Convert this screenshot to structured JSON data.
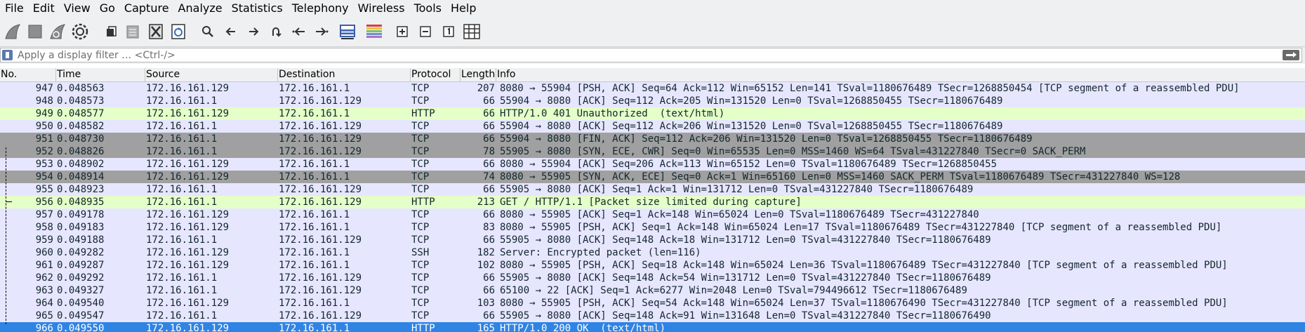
{
  "menu": [
    "File",
    "Edit",
    "View",
    "Go",
    "Capture",
    "Analyze",
    "Statistics",
    "Telephony",
    "Wireless",
    "Tools",
    "Help"
  ],
  "toolbar_icons": [
    "shark-fin-start-icon",
    "stop-square-icon",
    "shark-fin-restart-icon",
    "gear-options-icon",
    "open-file-icon",
    "save-file-icon",
    "close-file-icon",
    "reload-file-icon",
    "search-icon",
    "arrow-left-icon",
    "arrow-right-icon",
    "jump-to-packet-icon",
    "first-packet-icon",
    "last-packet-icon",
    "auto-scroll-icon",
    "colorize-icon",
    "zoom-in-icon",
    "zoom-out-icon",
    "zoom-normal-icon",
    "resize-columns-icon"
  ],
  "filter": {
    "placeholder": "Apply a display filter … <Ctrl-/>"
  },
  "columns": {
    "no": "No.",
    "time": "Time",
    "source": "Source",
    "destination": "Destination",
    "protocol": "Protocol",
    "length": "Length",
    "info": "Info"
  },
  "colors": {
    "tcp": "#e7e6ff",
    "http": "#e4ffc7",
    "syn_fin": "#a0a0a0",
    "selected": "#2f84e3",
    "text": "#12272e"
  },
  "packets": [
    {
      "no": "947",
      "time": "0.048563",
      "source": "172.16.161.129",
      "destination": "172.16.161.1",
      "protocol": "TCP",
      "length": "207",
      "info": "8080 → 55904 [PSH, ACK] Seq=64 Ack=112 Win=65152 Len=141 TSval=1180676489 TSecr=1268850454 [TCP segment of a reassembled PDU]",
      "color": "tcp"
    },
    {
      "no": "948",
      "time": "0.048573",
      "source": "172.16.161.1",
      "destination": "172.16.161.129",
      "protocol": "TCP",
      "length": "66",
      "info": "55904 → 8080 [ACK] Seq=112 Ack=205 Win=131520 Len=0 TSval=1268850455 TSecr=1180676489",
      "color": "tcp"
    },
    {
      "no": "949",
      "time": "0.048577",
      "source": "172.16.161.129",
      "destination": "172.16.161.1",
      "protocol": "HTTP",
      "length": "66",
      "info": "HTTP/1.0 401 Unauthorized  (text/html)",
      "color": "http"
    },
    {
      "no": "950",
      "time": "0.048582",
      "source": "172.16.161.1",
      "destination": "172.16.161.129",
      "protocol": "TCP",
      "length": "66",
      "info": "55904 → 8080 [ACK] Seq=112 Ack=206 Win=131520 Len=0 TSval=1268850455 TSecr=1180676489",
      "color": "tcp"
    },
    {
      "no": "951",
      "time": "0.048730",
      "source": "172.16.161.1",
      "destination": "172.16.161.129",
      "protocol": "TCP",
      "length": "66",
      "info": "55904 → 8080 [FIN, ACK] Seq=112 Ack=206 Win=131520 Len=0 TSval=1268850455 TSecr=1180676489",
      "color": "syn_fin"
    },
    {
      "no": "952",
      "time": "0.048826",
      "source": "172.16.161.1",
      "destination": "172.16.161.129",
      "protocol": "TCP",
      "length": "78",
      "info": "55905 → 8080 [SYN, ECE, CWR] Seq=0 Win=65535 Len=0 MSS=1460 WS=64 TSval=431227840 TSecr=0 SACK_PERM",
      "color": "syn_fin"
    },
    {
      "no": "953",
      "time": "0.048902",
      "source": "172.16.161.129",
      "destination": "172.16.161.1",
      "protocol": "TCP",
      "length": "66",
      "info": "8080 → 55904 [ACK] Seq=206 Ack=113 Win=65152 Len=0 TSval=1180676489 TSecr=1268850455",
      "color": "tcp"
    },
    {
      "no": "954",
      "time": "0.048914",
      "source": "172.16.161.129",
      "destination": "172.16.161.1",
      "protocol": "TCP",
      "length": "74",
      "info": "8080 → 55905 [SYN, ACK, ECE] Seq=0 Ack=1 Win=65160 Len=0 MSS=1460 SACK_PERM TSval=1180676489 TSecr=431227840 WS=128",
      "color": "syn_fin"
    },
    {
      "no": "955",
      "time": "0.048923",
      "source": "172.16.161.1",
      "destination": "172.16.161.129",
      "protocol": "TCP",
      "length": "66",
      "info": "55905 → 8080 [ACK] Seq=1 Ack=1 Win=131712 Len=0 TSval=431227840 TSecr=1180676489",
      "color": "tcp"
    },
    {
      "no": "956",
      "time": "0.048935",
      "source": "172.16.161.1",
      "destination": "172.16.161.129",
      "protocol": "HTTP",
      "length": "213",
      "info": "GET / HTTP/1.1 [Packet size limited during capture]",
      "color": "http"
    },
    {
      "no": "957",
      "time": "0.049178",
      "source": "172.16.161.129",
      "destination": "172.16.161.1",
      "protocol": "TCP",
      "length": "66",
      "info": "8080 → 55905 [ACK] Seq=1 Ack=148 Win=65024 Len=0 TSval=1180676489 TSecr=431227840",
      "color": "tcp"
    },
    {
      "no": "958",
      "time": "0.049183",
      "source": "172.16.161.129",
      "destination": "172.16.161.1",
      "protocol": "TCP",
      "length": "83",
      "info": "8080 → 55905 [PSH, ACK] Seq=1 Ack=148 Win=65024 Len=17 TSval=1180676489 TSecr=431227840 [TCP segment of a reassembled PDU]",
      "color": "tcp"
    },
    {
      "no": "959",
      "time": "0.049188",
      "source": "172.16.161.1",
      "destination": "172.16.161.129",
      "protocol": "TCP",
      "length": "66",
      "info": "55905 → 8080 [ACK] Seq=148 Ack=18 Win=131712 Len=0 TSval=431227840 TSecr=1180676489",
      "color": "tcp"
    },
    {
      "no": "960",
      "time": "0.049282",
      "source": "172.16.161.129",
      "destination": "172.16.161.1",
      "protocol": "SSH",
      "length": "182",
      "info": "Server: Encrypted packet (len=116)",
      "color": "tcp"
    },
    {
      "no": "961",
      "time": "0.049287",
      "source": "172.16.161.129",
      "destination": "172.16.161.1",
      "protocol": "TCP",
      "length": "102",
      "info": "8080 → 55905 [PSH, ACK] Seq=18 Ack=148 Win=65024 Len=36 TSval=1180676489 TSecr=431227840 [TCP segment of a reassembled PDU]",
      "color": "tcp"
    },
    {
      "no": "962",
      "time": "0.049292",
      "source": "172.16.161.1",
      "destination": "172.16.161.129",
      "protocol": "TCP",
      "length": "66",
      "info": "55905 → 8080 [ACK] Seq=148 Ack=54 Win=131712 Len=0 TSval=431227840 TSecr=1180676489",
      "color": "tcp"
    },
    {
      "no": "963",
      "time": "0.049327",
      "source": "172.16.161.1",
      "destination": "172.16.161.129",
      "protocol": "TCP",
      "length": "66",
      "info": "65100 → 22 [ACK] Seq=1 Ack=6277 Win=2048 Len=0 TSval=794496612 TSecr=1180676489",
      "color": "tcp"
    },
    {
      "no": "964",
      "time": "0.049540",
      "source": "172.16.161.129",
      "destination": "172.16.161.1",
      "protocol": "TCP",
      "length": "103",
      "info": "8080 → 55905 [PSH, ACK] Seq=54 Ack=148 Win=65024 Len=37 TSval=1180676490 TSecr=431227840 [TCP segment of a reassembled PDU]",
      "color": "tcp"
    },
    {
      "no": "965",
      "time": "0.049547",
      "source": "172.16.161.1",
      "destination": "172.16.161.129",
      "protocol": "TCP",
      "length": "66",
      "info": "55905 → 8080 [ACK] Seq=148 Ack=91 Win=131648 Len=0 TSval=431227840 TSecr=1180676490",
      "color": "tcp"
    },
    {
      "no": "966",
      "time": "0.049550",
      "source": "172.16.161.129",
      "destination": "172.16.161.1",
      "protocol": "HTTP",
      "length": "165",
      "info": "HTTP/1.0 200 OK  (text/html)",
      "color": "selected"
    }
  ]
}
